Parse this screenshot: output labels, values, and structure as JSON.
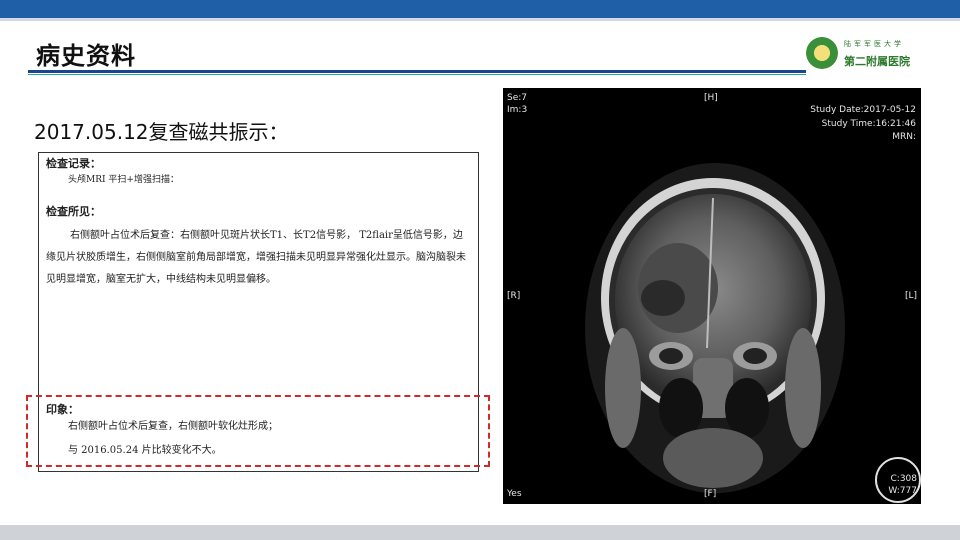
{
  "slide": {
    "title": "病史资料",
    "subtitle": "2017.05.12复查磁共振示：",
    "logo": {
      "line1": "陆军军医大学",
      "line2": "第二附属医院"
    }
  },
  "report": {
    "section1_heading": "检查记录：",
    "section1_text": "头颅MRI 平扫+增强扫描：",
    "section2_heading": "检查所见：",
    "section2_text": "右侧额叶占位术后复查：右侧额叶见斑片状长T1、长T2信号影， T2flair呈低信号影，边缘见片状胶质增生，右侧侧脑室前角局部增宽，增强扫描未见明显异常强化灶显示。脑沟脑裂未见明显增宽，脑室无扩大，中线结构未见明显偏移。",
    "impression_heading": "印象：",
    "impression_line1": "右侧额叶占位术后复查，右侧额叶软化灶形成；",
    "impression_line2": "与 2016.05.24 片比较变化不大。"
  },
  "mri": {
    "se": "Se:7",
    "im": "Im:3",
    "top_marker": "[H]",
    "study_date": "Study Date:2017-05-12",
    "study_time": "Study Time:16:21:46",
    "mrn": "MRN:",
    "right_label": "[R]",
    "left_label": "[L]",
    "bottom_marker": "[F]",
    "yes_label": "Yes",
    "br_line1": "C:308",
    "br_line2": "W:777"
  },
  "colors": {
    "topbar": "#1f5fa8",
    "title_rule": "#17478f",
    "highlight_box": "#d02a2a",
    "logo_green": "#2d7a2d"
  }
}
